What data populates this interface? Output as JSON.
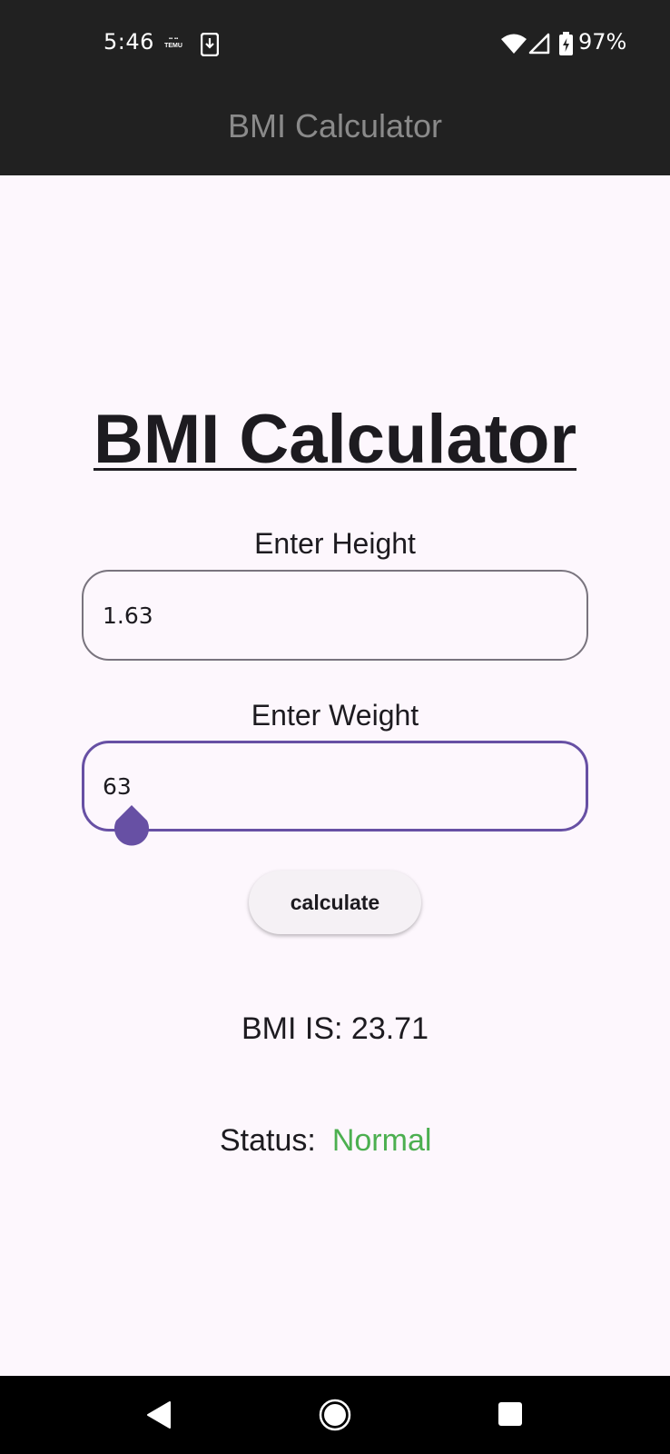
{
  "status_bar": {
    "time": "5:46",
    "notification_icons": [
      "temu-icon",
      "download-icon"
    ],
    "temu_text": "TEMU",
    "system_icons": [
      "wifi-icon",
      "signal-icon",
      "battery-charging-icon"
    ],
    "battery_percent": "97%"
  },
  "app_bar": {
    "title": "BMI Calculator"
  },
  "main": {
    "heading": "BMI Calculator",
    "height": {
      "label": "Enter Height",
      "value": "1.63"
    },
    "weight": {
      "label": "Enter Weight",
      "value": "63"
    },
    "calculate_label": "calculate",
    "result_text": "BMI IS: 23.71",
    "status_label": "Status:",
    "status_value": "Normal"
  },
  "nav_bar": {
    "buttons": [
      "back-icon",
      "home-icon",
      "recents-icon"
    ]
  },
  "colors": {
    "background": "#fdf7fd",
    "bar": "#212121",
    "accent": "#6750a4",
    "status_normal": "#4caf50",
    "field_border": "#79747e"
  }
}
